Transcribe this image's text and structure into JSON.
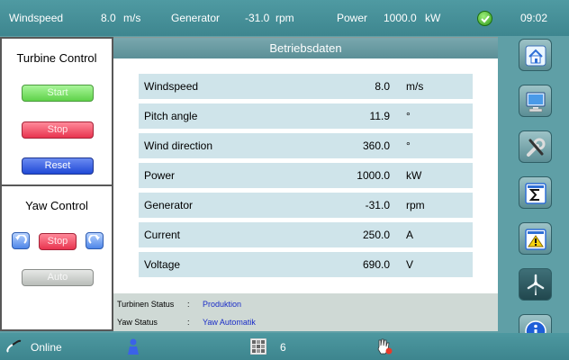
{
  "topbar": {
    "windspeed_label": "Windspeed",
    "windspeed_value": "8.0",
    "windspeed_unit": "m/s",
    "generator_label": "Generator",
    "generator_value": "-31.0",
    "generator_unit": "rpm",
    "power_label": "Power",
    "power_value": "1000.0",
    "power_unit": "kW",
    "status_icon": "ok-check-icon",
    "clock": "09:02"
  },
  "left_panel": {
    "turbine_title": "Turbine Control",
    "start_label": "Start",
    "stop_label": "Stop",
    "reset_label": "Reset",
    "yaw_title": "Yaw Control",
    "yaw_stop_label": "Stop",
    "auto_label": "Auto"
  },
  "main": {
    "title": "Betriebsdaten",
    "rows": [
      {
        "label": "Windspeed",
        "value": "8.0",
        "unit": "m/s"
      },
      {
        "label": "Pitch angle",
        "value": "11.9",
        "unit": "°"
      },
      {
        "label": "Wind direction",
        "value": "360.0",
        "unit": "°"
      },
      {
        "label": "Power",
        "value": "1000.0",
        "unit": "kW"
      },
      {
        "label": "Generator",
        "value": "-31.0",
        "unit": "rpm"
      },
      {
        "label": "Current",
        "value": "250.0",
        "unit": "A"
      },
      {
        "label": "Voltage",
        "value": "690.0",
        "unit": "V"
      }
    ],
    "status": [
      {
        "label": "Turbinen Status",
        "sep": ":",
        "value": "Produktion"
      },
      {
        "label": "Yaw Status",
        "sep": ":",
        "value": "Yaw Automatik"
      }
    ]
  },
  "nav": [
    "home-icon",
    "monitor-icon",
    "tools-icon",
    "sigma-icon",
    "warning-icon",
    "turbine-icon",
    "info-icon"
  ],
  "bottombar": {
    "connection_label": "Online",
    "count_value": "6"
  },
  "colors": {
    "accent": "#4f9aa2",
    "row_bg": "#cfe4ea",
    "start": "#5fd24a",
    "stop": "#e8344f",
    "reset": "#2049d6",
    "status_value": "#1a2cc7"
  }
}
